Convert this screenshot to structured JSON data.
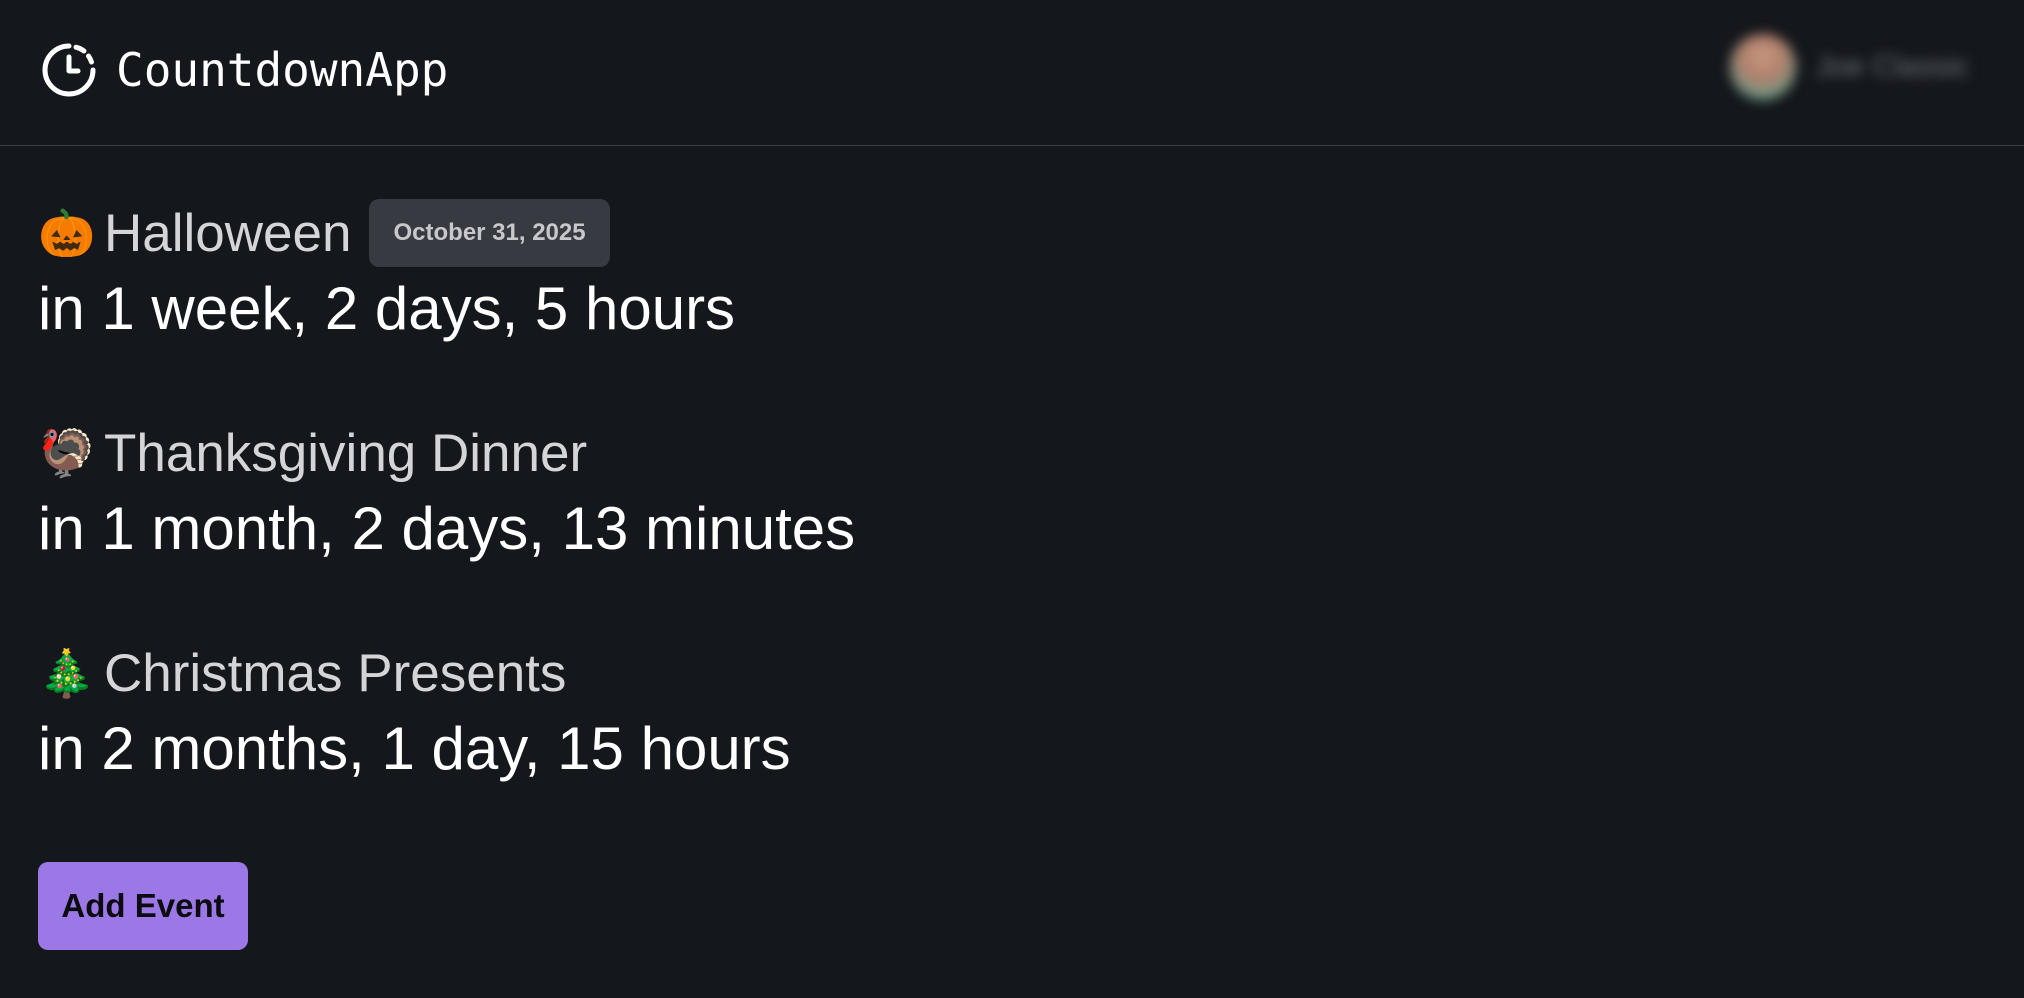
{
  "app": {
    "name": "CountdownApp",
    "icon": "clock-countdown-icon"
  },
  "user": {
    "name": "Joe Classic",
    "avatar_icon": "user-avatar"
  },
  "events": [
    {
      "emoji": "🎃",
      "title": "Halloween",
      "date_badge": "October 31, 2025",
      "countdown": "in 1 week, 2 days, 5 hours"
    },
    {
      "emoji": "🦃",
      "title": "Thanksgiving Dinner",
      "date_badge": "",
      "countdown": "in 1 month, 2 days, 13 minutes"
    },
    {
      "emoji": "🎄",
      "title": "Christmas Presents",
      "date_badge": "",
      "countdown": "in 2 months, 1 day, 15 hours"
    }
  ],
  "actions": {
    "add_event_label": "Add Event"
  },
  "colors": {
    "background": "#14171c",
    "accent": "#9b78e6",
    "badge_bg": "#373a41"
  }
}
